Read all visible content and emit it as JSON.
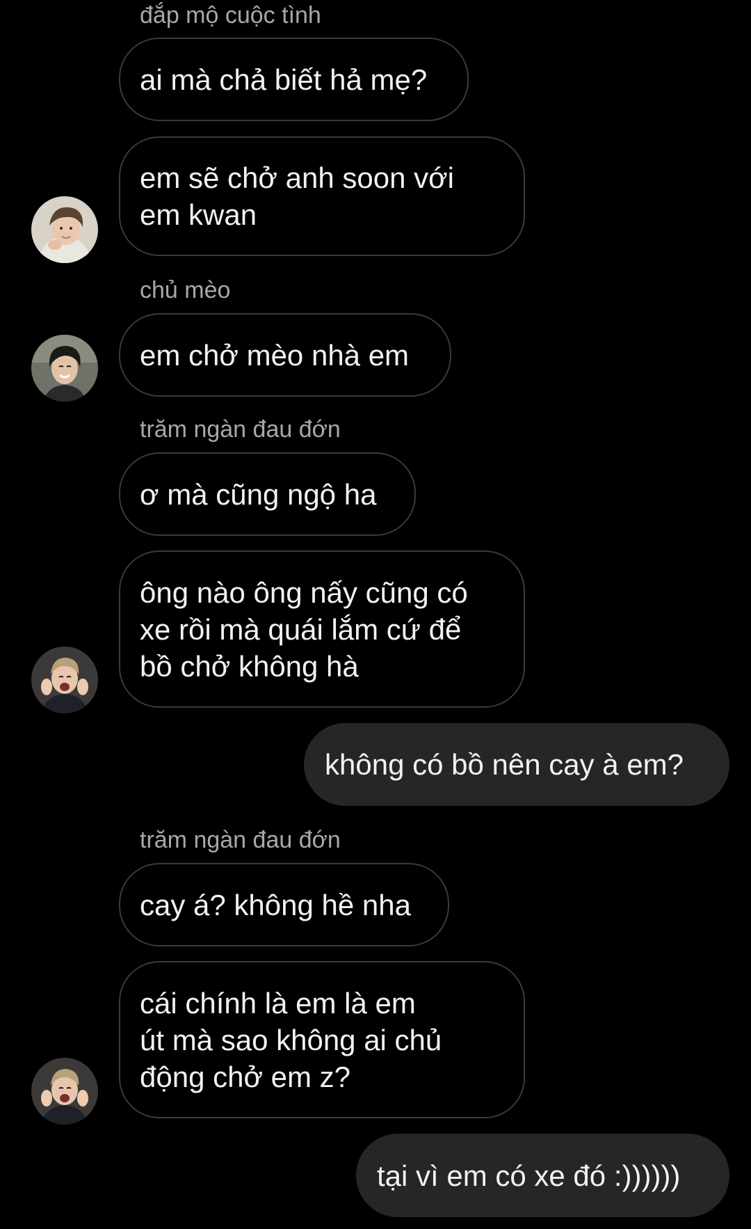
{
  "thread": {
    "messages": [
      {
        "id": "m1",
        "sender_name": "đắp mộ cuộc tình",
        "text": "ai mà chả biết hả mẹ?"
      },
      {
        "id": "m2",
        "text": "em sẽ chở anh soon với\nem kwan",
        "avatar": "avatar-boy-light"
      },
      {
        "id": "m3",
        "sender_name": "chủ mèo",
        "text": "em chở mèo nhà em",
        "avatar": "avatar-boy-smile"
      },
      {
        "id": "m4",
        "sender_name": "trăm ngàn đau đớn",
        "text": "ơ mà cũng ngộ ha"
      },
      {
        "id": "m5",
        "text": "ông nào ông nấy cũng có\nxe rồi mà quái lắm cứ để\nbồ chở không hà",
        "avatar": "avatar-boy-cheer"
      },
      {
        "id": "m6",
        "text": "không có bồ nên cay à em?"
      },
      {
        "id": "m7",
        "sender_name": "trăm ngàn đau đớn",
        "text": "cay á? không hề nha"
      },
      {
        "id": "m8",
        "text": "cái chính là em là em\nút mà sao không ai chủ\nđộng chở em z?",
        "avatar": "avatar-boy-cheer"
      },
      {
        "id": "m9",
        "text": "tại vì em có xe đó :))))))"
      }
    ]
  },
  "colors": {
    "background": "#000000",
    "incoming_border": "#3a3a3a",
    "outgoing_bubble": "#262626",
    "text": "#f2f2f2",
    "sender_name": "#a8a8a8"
  }
}
